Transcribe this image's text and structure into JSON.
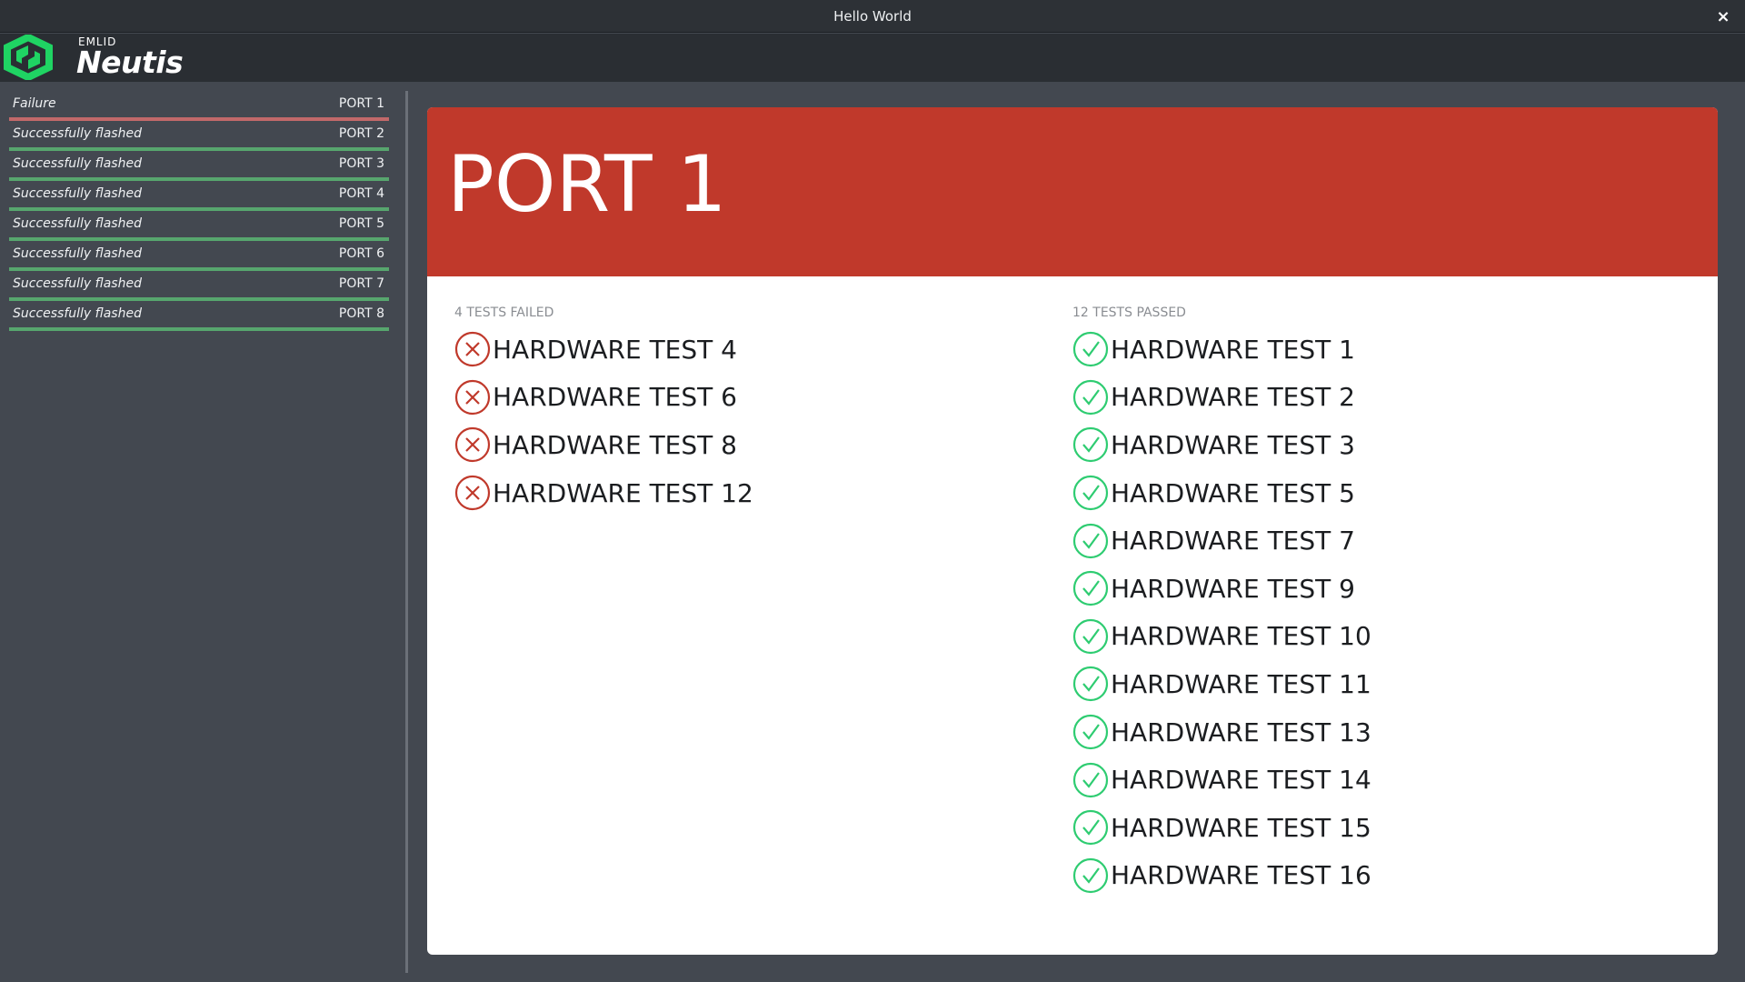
{
  "window": {
    "title": "Hello World",
    "close_label": "×"
  },
  "logo": {
    "brand_small": "EMLID",
    "brand_large": "Neutis",
    "icon": "neutis-logo-icon",
    "accent": "#1fd463"
  },
  "colors": {
    "failure": "#c0392b",
    "failure_bar": "#c2696a",
    "success_bar": "#57a66e",
    "pass_icon": "#2ecc71",
    "fail_icon": "#c0392b"
  },
  "sidebar": {
    "items": [
      {
        "status": "Failure",
        "port": "PORT 1",
        "state": "failure"
      },
      {
        "status": "Successfully flashed",
        "port": "PORT 2",
        "state": "success"
      },
      {
        "status": "Successfully flashed",
        "port": "PORT 3",
        "state": "success"
      },
      {
        "status": "Successfully flashed",
        "port": "PORT 4",
        "state": "success"
      },
      {
        "status": "Successfully flashed",
        "port": "PORT 5",
        "state": "success"
      },
      {
        "status": "Successfully flashed",
        "port": "PORT 6",
        "state": "success"
      },
      {
        "status": "Successfully flashed",
        "port": "PORT 7",
        "state": "success"
      },
      {
        "status": "Successfully flashed",
        "port": "PORT 8",
        "state": "success"
      }
    ]
  },
  "main": {
    "title": "PORT 1",
    "failed": {
      "heading": "4 TESTS FAILED",
      "tests": [
        "HARDWARE TEST 4",
        "HARDWARE TEST 6",
        "HARDWARE TEST 8",
        "HARDWARE TEST 12"
      ]
    },
    "passed": {
      "heading": "12 TESTS PASSED",
      "tests": [
        "HARDWARE TEST 1",
        "HARDWARE TEST 2",
        "HARDWARE TEST 3",
        "HARDWARE TEST 5",
        "HARDWARE TEST 7",
        "HARDWARE TEST 9",
        "HARDWARE TEST 10",
        "HARDWARE TEST 11",
        "HARDWARE TEST 13",
        "HARDWARE TEST 14",
        "HARDWARE TEST 15",
        "HARDWARE TEST 16"
      ]
    }
  }
}
